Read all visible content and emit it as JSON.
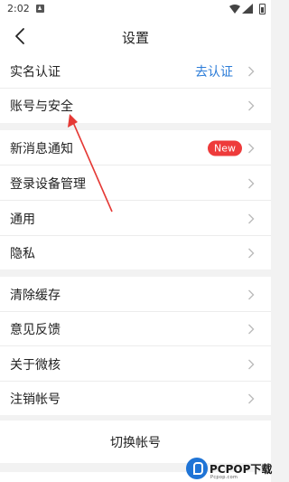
{
  "status_bar": {
    "time": "2:02"
  },
  "header": {
    "title": "设置"
  },
  "groups": [
    {
      "items": [
        {
          "label": "实名认证",
          "value": "去认证"
        },
        {
          "label": "账号与安全"
        }
      ]
    },
    {
      "items": [
        {
          "label": "新消息通知",
          "badge": "New"
        },
        {
          "label": "登录设备管理"
        },
        {
          "label": "通用"
        },
        {
          "label": "隐私"
        }
      ]
    },
    {
      "items": [
        {
          "label": "清除缓存"
        },
        {
          "label": "意见反馈"
        },
        {
          "label": "关于微核"
        },
        {
          "label": "注销帐号"
        }
      ]
    }
  ],
  "switch_account": {
    "label": "切换帐号"
  },
  "watermark": {
    "text": "PCPOP下载",
    "sub": "Pcpop.com"
  },
  "colors": {
    "value_blue": "#2b7cd8",
    "badge_red": "#ee3b3b",
    "annotation_red": "#e53935"
  }
}
